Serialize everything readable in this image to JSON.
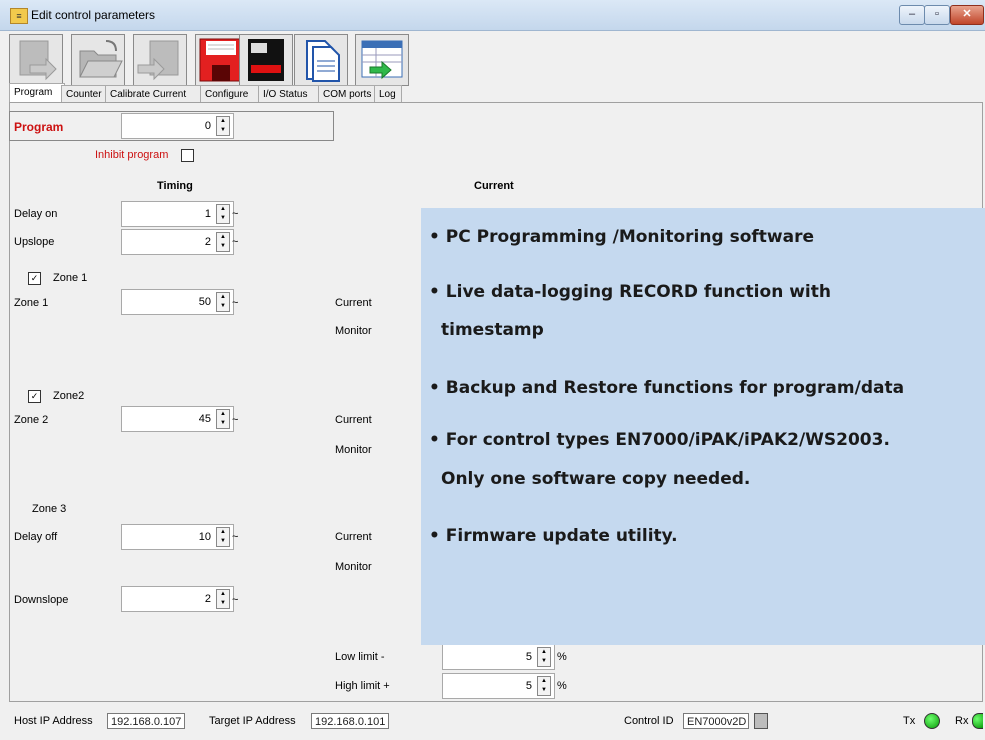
{
  "window": {
    "title": "Edit control parameters",
    "min": "–",
    "max": "▫",
    "close": "✕"
  },
  "tabs": [
    "Program",
    "Counter",
    "Calibrate Current",
    "Configure",
    "I/O Status",
    "COM ports",
    "Log"
  ],
  "program": {
    "label": "Program",
    "value": "0"
  },
  "inhibit": {
    "label": "Inhibit program"
  },
  "headers": {
    "timing": "Timing",
    "current": "Current"
  },
  "rows": {
    "delay_on": {
      "label": "Delay on",
      "value": "1"
    },
    "upslope": {
      "label": "Upslope",
      "value": "2"
    },
    "zone1_check": "Zone 1",
    "zone1": {
      "label": "Zone 1",
      "value": "50"
    },
    "zone2_check": "Zone2",
    "zone2": {
      "label": "Zone 2",
      "value": "45"
    },
    "zone3": "Zone 3",
    "delay_off": {
      "label": "Delay off",
      "value": "10"
    },
    "downslope": {
      "label": "Downslope",
      "value": "2"
    }
  },
  "tilde": "~",
  "current_labels": {
    "current": "Current",
    "monitor": "Monitor"
  },
  "limits": {
    "low": {
      "label": "Low limit -",
      "value": "5",
      "unit": "%"
    },
    "high": {
      "label": "High limit +",
      "value": "5",
      "unit": "%"
    }
  },
  "overlay": {
    "b1": "• PC Programming /Monitoring software",
    "b2a": "• Live data-logging RECORD function with",
    "b2b": "timestamp",
    "b3": "• Backup and Restore functions for program/data",
    "b4a": "• For control types EN7000/iPAK/iPAK2/WS2003.",
    "b4b": "Only one software copy needed.",
    "b5": "• Firmware update utility."
  },
  "status": {
    "host_label": "Host IP Address",
    "host_value": "192.168.0.107",
    "target_label": "Target IP Address",
    "target_value": "192.168.0.101",
    "control_label": "Control ID",
    "control_value": "EN7000v2D",
    "tx": "Tx",
    "rx": "Rx"
  },
  "colors": {
    "overlay_bg": "#c5d9ef",
    "program_label": "#cc1111",
    "led": "#12c412"
  }
}
